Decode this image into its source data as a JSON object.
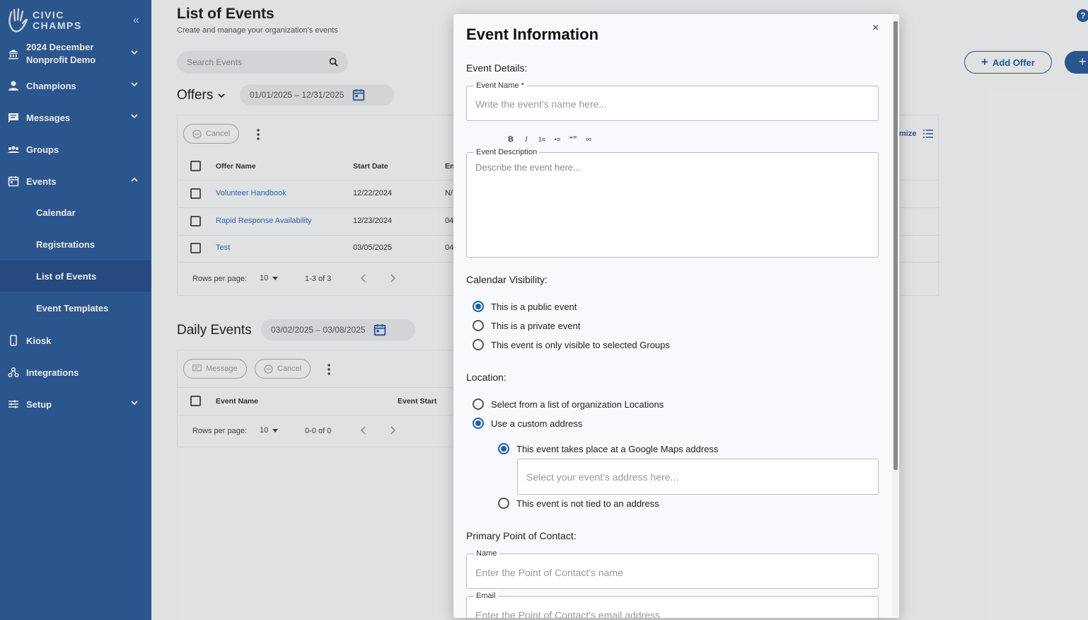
{
  "sidebar": {
    "logo": [
      "CIVIC",
      "CHAMPS"
    ],
    "org": [
      "2024 December",
      "Nonprofit Demo"
    ],
    "items": [
      {
        "label": "Champions"
      },
      {
        "label": "Messages"
      },
      {
        "label": "Groups"
      },
      {
        "label": "Events"
      },
      {
        "label": "Kiosk"
      },
      {
        "label": "Integrations"
      },
      {
        "label": "Setup"
      }
    ],
    "sub_items": [
      {
        "label": "Calendar"
      },
      {
        "label": "Registrations"
      },
      {
        "label": "List of Events"
      },
      {
        "label": "Event Templates"
      }
    ]
  },
  "page": {
    "title": "List of Events",
    "subtitle": "Create and manage your organization's events",
    "search_placeholder": "Search Events",
    "add_offer_label": "Add Offer",
    "add_icon": "+",
    "help_icon": "?"
  },
  "offers": {
    "title": "Offers",
    "date_range": "01/01/2025  – 12/31/2025",
    "cancel_label": "Cancel",
    "customize_label": "mize",
    "columns": [
      "Offer Name",
      "Start Date",
      "En"
    ],
    "rows": [
      {
        "name": "Volunteer Handbook",
        "start": "12/22/2024",
        "end": "N/"
      },
      {
        "name": "Rapid Response Availability",
        "start": "12/23/2024",
        "end": "04"
      },
      {
        "name": "Test",
        "start": "03/05/2025",
        "end": "04"
      }
    ],
    "rows_per_page_label": "Rows per page:",
    "rows_per_page": "10",
    "range": "1-3 of 3"
  },
  "daily": {
    "title": "Daily Events",
    "date_range": "03/02/2025  – 03/08/2025",
    "message_label": "Message",
    "cancel_label": "Cancel",
    "columns": [
      "Event Name",
      "Event Start"
    ],
    "rows_per_page_label": "Rows per page:",
    "rows_per_page": "10",
    "range": "0-0 of 0"
  },
  "modal": {
    "title": "Event Information",
    "close": "×",
    "event_details": "Event Details:",
    "event_name_legend": "Event Name *",
    "event_name_placeholder": "Write the event's name here...",
    "toolbar": [
      "B",
      "I",
      "1≡",
      "•≡",
      "“”",
      "∞"
    ],
    "description_legend": "Event Description",
    "description_placeholder": "Describe the event here...",
    "calendar_visibility": "Calendar Visibility:",
    "visibility_options": [
      {
        "label": "This is a public event",
        "selected": true
      },
      {
        "label": "This is a private event",
        "selected": false
      },
      {
        "label": "This event is only visible to selected Groups",
        "selected": false
      }
    ],
    "location": "Location:",
    "location_options": [
      {
        "label": "Select from a list of organization Locations",
        "selected": false
      },
      {
        "label": "Use a custom address",
        "selected": true
      }
    ],
    "address_options": [
      {
        "label": "This event takes place at a Google Maps address",
        "selected": true
      },
      {
        "label": "This event is not tied to an address",
        "selected": false
      }
    ],
    "address_placeholder": "Select your event's address here...",
    "poc": "Primary Point of Contact:",
    "name_legend": "Name",
    "name_placeholder": "Enter the Point of Contact's name",
    "email_legend": "Email",
    "email_placeholder": "Enter the Point of Contact's email address"
  },
  "colors": {
    "sidebar": "#2f5d99",
    "accent": "#1f5ea8",
    "link": "#2f6db5"
  }
}
